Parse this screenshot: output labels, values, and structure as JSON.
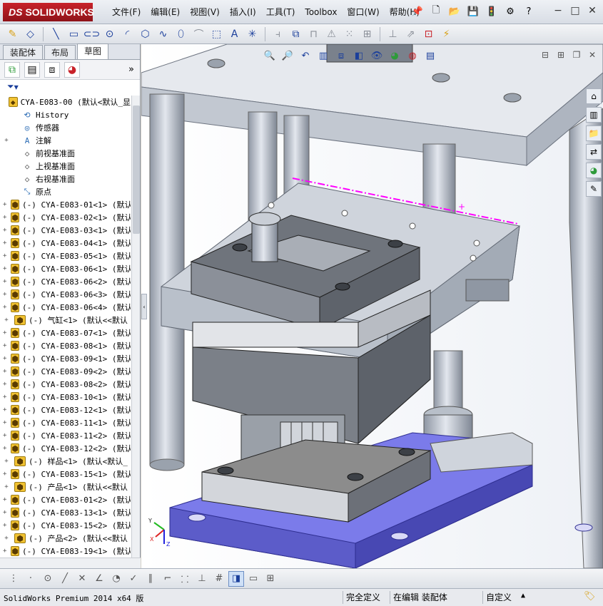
{
  "app": {
    "logo_ds": "DS",
    "logo_text": "SOLIDWORKS"
  },
  "menus": [
    "文件(F)",
    "编辑(E)",
    "视图(V)",
    "插入(I)",
    "工具(T)",
    "Toolbox",
    "窗口(W)",
    "帮助(H)"
  ],
  "left_panel": {
    "tabs": [
      "装配体",
      "布局",
      "草图"
    ],
    "active_tab": "草图",
    "more_glyph": "»",
    "filter_glyph": "▼"
  },
  "tree": {
    "root": "CYA-E083-00  (默认<默认_显",
    "fixed_nodes": [
      {
        "label": "History",
        "icon": "history-icon",
        "expander": ""
      },
      {
        "label": "传感器",
        "icon": "sensor-icon",
        "expander": ""
      },
      {
        "label": "注解",
        "icon": "annotation-icon",
        "expander": "+"
      },
      {
        "label": "前视基准面",
        "icon": "plane-icon",
        "expander": ""
      },
      {
        "label": "上视基准面",
        "icon": "plane-icon",
        "expander": ""
      },
      {
        "label": "右视基准面",
        "icon": "plane-icon",
        "expander": ""
      },
      {
        "label": "原点",
        "icon": "origin-icon",
        "expander": ""
      }
    ],
    "components": [
      "(-) CYA-E083-01<1> (默认",
      "(-) CYA-E083-02<1> (默认",
      "(-) CYA-E083-03<1> (默认",
      "(-) CYA-E083-04<1> (默认",
      "(-) CYA-E083-05<1> (默认",
      "(-) CYA-E083-06<1> (默认",
      "(-) CYA-E083-06<2> (默认",
      "(-) CYA-E083-06<3> (默认",
      "(-) CYA-E083-06<4> (默认",
      "(-) 气缸<1> (默认<<默认",
      "(-) CYA-E083-07<1> (默认",
      "(-) CYA-E083-08<1> (默认",
      "(-) CYA-E083-09<1> (默认",
      "(-) CYA-E083-09<2> (默认",
      "(-) CYA-E083-08<2> (默认",
      "(-) CYA-E083-10<1> (默认",
      "(-) CYA-E083-12<1> (默认",
      "(-) CYA-E083-11<1> (默认",
      "(-) CYA-E083-11<2> (默认",
      "(-) CYA-E083-12<2> (默认",
      "(-) 样品<1> (默认<默认_",
      "(-) CYA-E083-15<1> (默认",
      "(-) 产品<1> (默认<<默认",
      "(-) CYA-E083-01<2> (默认",
      "(-) CYA-E083-13<1> (默认",
      "(-) CYA-E083-15<2> (默认",
      "(-) 产品<2> (默认<<默认",
      "(-) CYA-E083-19<1> (默认"
    ],
    "expander": "+"
  },
  "status": {
    "app_version": "SolidWorks Premium 2014 x64 版",
    "definition": "完全定义",
    "editing": "在编辑 装配体",
    "units": "自定义",
    "units_arrow": "▲"
  },
  "colors": {
    "logo_red": "#c8222a",
    "sketch_line": "#ff00ff",
    "base_plate": "#7b7bea",
    "die_block": "#8c8c8c"
  }
}
